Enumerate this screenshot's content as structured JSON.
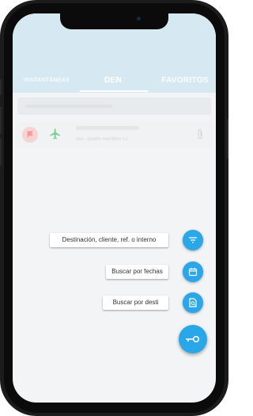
{
  "tabs": [
    {
      "label": "INSTANTÁNEAS"
    },
    {
      "label": "DEN"
    },
    {
      "label": "FAVORITOS"
    }
  ],
  "card": {
    "subtitle": "ven - puerto marítimo s.l."
  },
  "fab_menu": {
    "option_1": "Destinación, cliente, ref. o interno",
    "option_2": "Buscar por fechas",
    "option_3": "Buscar por desti"
  },
  "icons": {
    "filter": "filter-icon",
    "calendar": "calendar-icon",
    "document_search": "document-search-icon",
    "key": "key-icon"
  },
  "colors": {
    "accent": "#29a7e8",
    "header": "#d6e9f3",
    "flag_bg": "#f8d3d3",
    "plane": "#7fcf93"
  }
}
